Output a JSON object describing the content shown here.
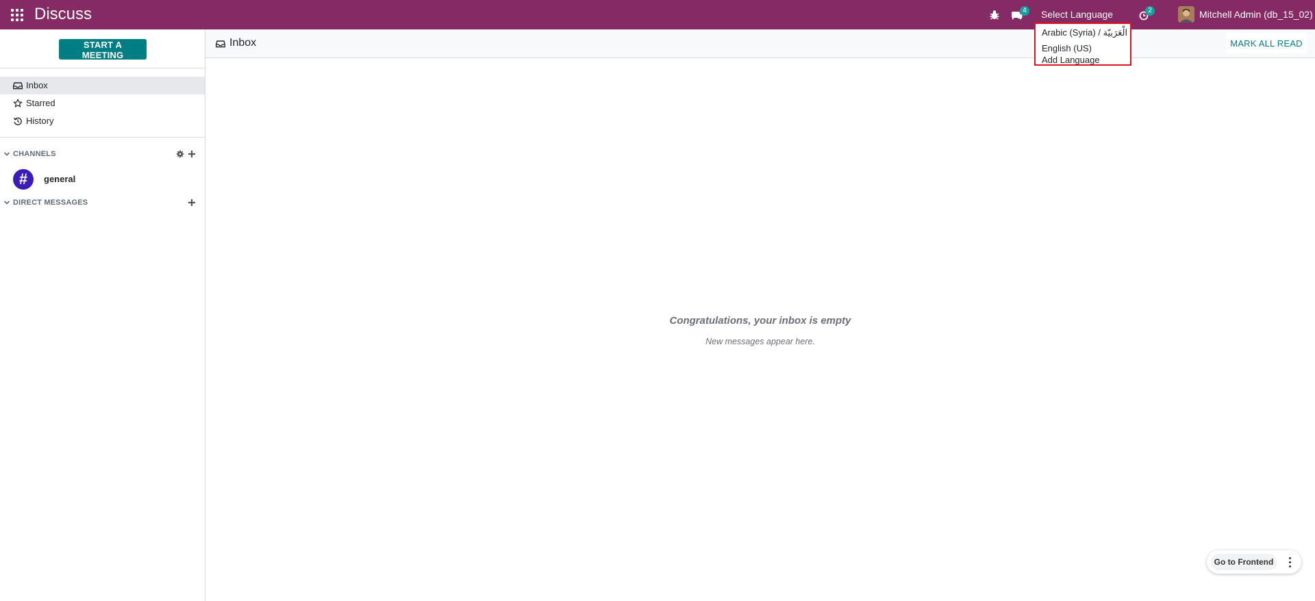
{
  "navbar": {
    "app_title": "Discuss",
    "messages_badge": "4",
    "activities_badge": "2",
    "language_toggle": "Select Language",
    "user_name": "Mitchell Admin (db_15_02)",
    "icons": [
      "apps-icon",
      "bug-icon",
      "chat-icon",
      "clock-icon"
    ],
    "colors": {
      "navbar": "#852a64",
      "badge": "#1a9e9e"
    }
  },
  "language_menu": {
    "items": [
      "Arabic (Syria) / الْعَرَبيّة",
      "English (US)",
      "Add Language"
    ],
    "highlight_color": "#e0141e"
  },
  "sidebar": {
    "start_meeting_label": "START A MEETING",
    "mailboxes": [
      {
        "label": "Inbox",
        "icon": "inbox-icon",
        "active": true
      },
      {
        "label": "Starred",
        "icon": "star-icon",
        "active": false
      },
      {
        "label": "History",
        "icon": "history-icon",
        "active": false
      }
    ],
    "channels_label": "CHANNELS",
    "channels": [
      {
        "name": "general",
        "avatar_glyph": "#"
      }
    ],
    "direct_messages_label": "DIRECT MESSAGES",
    "accent_color": "#017e84"
  },
  "main": {
    "title": "Inbox",
    "mark_all_read_label": "MARK ALL READ",
    "empty_title": "Congratulations, your inbox is empty",
    "empty_subtitle": "New messages appear here."
  },
  "frontend": {
    "button_label": "Go to Frontend"
  }
}
